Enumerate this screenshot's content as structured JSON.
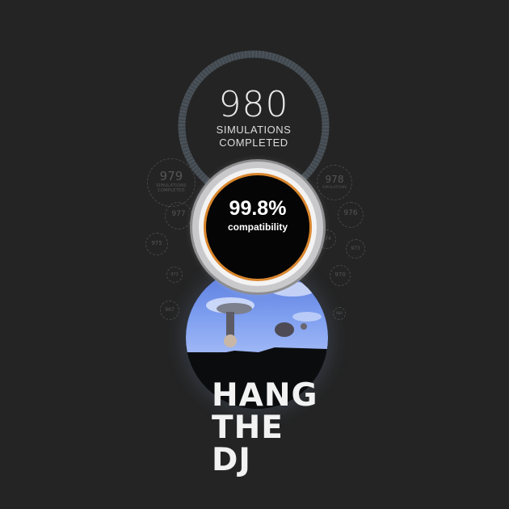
{
  "main_counter": {
    "value": "980",
    "caption_line1": "SIMULATIONS",
    "caption_line2": "COMPLETED"
  },
  "compatibility": {
    "percent": "99.8%",
    "label": "compatibility",
    "ring_color": "#d9862d"
  },
  "bubbles": {
    "b979": {
      "value": "979",
      "caption": "SIMULATIONS COMPLETED"
    },
    "b978": {
      "value": "978",
      "caption": "SIMULATIONS"
    },
    "b977": {
      "value": "977"
    },
    "b976": {
      "value": "976"
    },
    "b975": {
      "value": "975"
    },
    "b974": {
      "value": "974"
    },
    "b973": {
      "value": "973"
    },
    "b972": {
      "value": "972"
    },
    "b970": {
      "value": "970"
    },
    "b968": {
      "value": "968"
    },
    "b967": {
      "value": "967"
    }
  },
  "logo": {
    "line1": "HANG",
    "line2": "THE",
    "line3": "DJ"
  },
  "colors": {
    "background": "#242424",
    "accent": "#d9862d",
    "sky": "#6f8fe8"
  }
}
